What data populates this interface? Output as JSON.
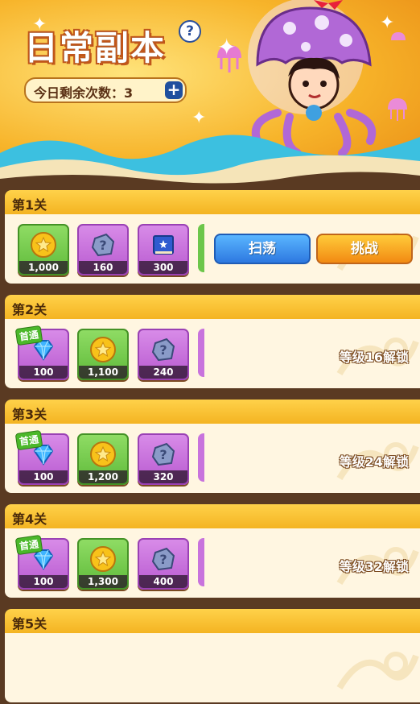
{
  "header": {
    "title": "日常副本",
    "help_icon_text": "?",
    "remaining_label": "今日剩余次数：3",
    "plus_icon_text": "+"
  },
  "stages": [
    {
      "label": "第1关",
      "rewards": [
        {
          "type": "gold-coin",
          "amount": "1,000",
          "color": "green",
          "first_clear": false
        },
        {
          "type": "stone",
          "amount": "160",
          "color": "purple",
          "first_clear": false
        },
        {
          "type": "book",
          "amount": "300",
          "color": "purple",
          "first_clear": false
        }
      ],
      "sweep_label": "扫荡",
      "challenge_label": "挑战",
      "unlocked": true
    },
    {
      "label": "第2关",
      "rewards": [
        {
          "type": "diamond",
          "amount": "100",
          "color": "purple",
          "first_clear": true
        },
        {
          "type": "gold-coin",
          "amount": "1,100",
          "color": "green",
          "first_clear": false
        },
        {
          "type": "stone",
          "amount": "240",
          "color": "purple",
          "first_clear": false
        }
      ],
      "lock_text": "等级16解锁",
      "unlocked": false
    },
    {
      "label": "第3关",
      "rewards": [
        {
          "type": "diamond",
          "amount": "100",
          "color": "purple",
          "first_clear": true
        },
        {
          "type": "gold-coin",
          "amount": "1,200",
          "color": "green",
          "first_clear": false
        },
        {
          "type": "stone",
          "amount": "320",
          "color": "purple",
          "first_clear": false
        }
      ],
      "lock_text": "等级24解锁",
      "unlocked": false
    },
    {
      "label": "第4关",
      "rewards": [
        {
          "type": "diamond",
          "amount": "100",
          "color": "purple",
          "first_clear": true
        },
        {
          "type": "gold-coin",
          "amount": "1,300",
          "color": "green",
          "first_clear": false
        },
        {
          "type": "stone",
          "amount": "400",
          "color": "purple",
          "first_clear": false
        }
      ],
      "lock_text": "等级32解锁",
      "unlocked": false
    },
    {
      "label": "第5关",
      "rewards": [],
      "unlocked": false
    }
  ],
  "first_clear_badge": "首通",
  "colors": {
    "header": "#f7b42a",
    "panel": "#fff6e1",
    "tab": "#ffd24a",
    "background": "#5a3a22"
  }
}
